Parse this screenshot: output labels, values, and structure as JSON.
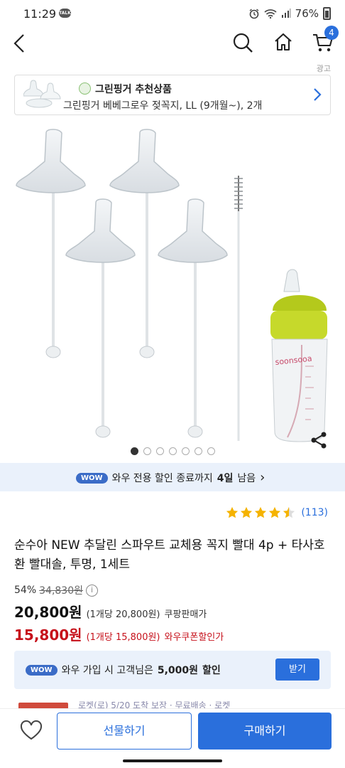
{
  "status_bar": {
    "time": "11:29",
    "talk_label": "TALK",
    "battery": "76%"
  },
  "nav": {
    "cart_count": "4"
  },
  "ad_label": "광고",
  "recommend": {
    "title": "그린핑거 추천상품",
    "product": "그린핑거 베베그로우 젖꼭지, LL (9개월~), 2개"
  },
  "gallery": {
    "bottle_brand": "soonsooa",
    "page_count": 7,
    "active_index": 0
  },
  "wow_banner": {
    "badge": "WOW",
    "text_before": "와우 전용 할인 종료까지",
    "highlight": "4일",
    "text_after": "남음",
    "chevron": "›"
  },
  "rating": {
    "stars": 4.5,
    "count": "(113)"
  },
  "product": {
    "title": "순수아 NEW 추달린 스파우트 교체용 꼭지 빨대 4p + 타사호환 빨대솔, 투명, 1세트"
  },
  "price": {
    "discount": "54%",
    "original": "34,830원",
    "info_icon": "i",
    "sale": "20,800원",
    "sale_unit": "(1개당 20,800원)",
    "sale_tag": "쿠팡판매가",
    "wow_price": "15,800원",
    "wow_unit": "(1개당 15,800원)",
    "wow_tag": "와우쿠폰할인가"
  },
  "signup": {
    "badge": "WOW",
    "text": "와우 가입 시 고객님은",
    "amount": "5,000원",
    "suffix": "할인",
    "button": "받기"
  },
  "partial_row": {
    "text": "로켓(로) 5/20 도착 보장 · 무료배송 · 로켓"
  },
  "bottom": {
    "gift": "선물하기",
    "buy": "구매하기"
  },
  "colors": {
    "accent": "#2a6fdc",
    "wow_red": "#c6111b",
    "star": "#f5b301",
    "wow_bg": "#eaf1fb"
  }
}
